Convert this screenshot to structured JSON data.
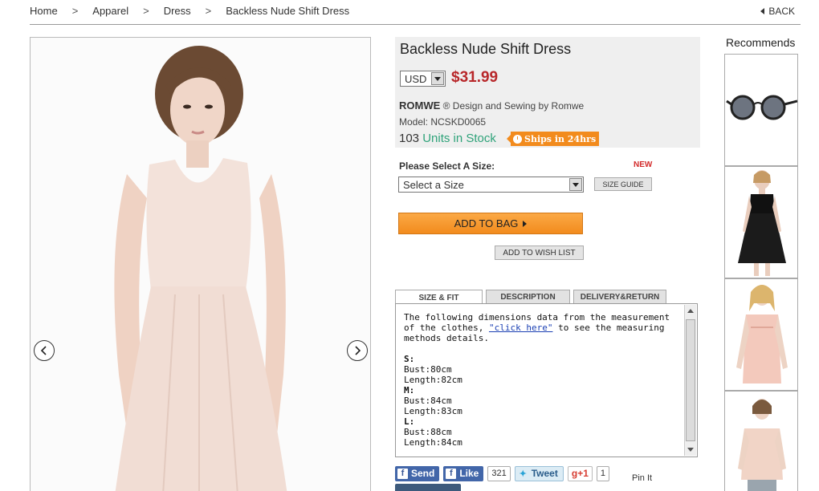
{
  "breadcrumb": {
    "items": [
      "Home",
      "Apparel",
      "Dress",
      "Backless Nude Shift Dress"
    ],
    "separator": ">"
  },
  "back_label": "BACK",
  "product": {
    "title": "Backless Nude Shift Dress",
    "currency": "USD",
    "price": "$31.99",
    "brand": "ROMWE",
    "brand_suffix": "® Design and Sewing by Romwe",
    "model": "Model: NCSKD0065",
    "stock_count": "103",
    "stock_label": "Units in Stock",
    "ships_badge": "Ships in 24hrs",
    "price_color": "#b8272a",
    "stock_color": "#2fa37a",
    "accent_orange": "#f28b1d"
  },
  "size": {
    "label": "Please Select A Size:",
    "new_badge": "NEW",
    "selected": "Select a Size",
    "guide_button": "SIZE GUIDE"
  },
  "actions": {
    "add_to_bag": "ADD TO BAG",
    "wish_list": "ADD TO WISH LIST"
  },
  "tabs": [
    {
      "label": "SIZE & FIT",
      "active": true
    },
    {
      "label": "DESCRIPTION",
      "active": false
    },
    {
      "label": "DELIVERY&RETURN",
      "active": false
    }
  ],
  "size_fit": {
    "intro_a": "The following dimensions data from the measurement of the clothes, ",
    "link": "\"click here\"",
    "intro_b": " to see the measuring methods details.",
    "sizes": [
      {
        "name": "S:",
        "bust": "Bust:80cm",
        "length": "Length:82cm"
      },
      {
        "name": "M:",
        "bust": "Bust:84cm",
        "length": "Length:83cm"
      },
      {
        "name": "L:",
        "bust": "Bust:88cm",
        "length": "Length:84cm"
      }
    ]
  },
  "social": {
    "send": "Send",
    "like": "Like",
    "like_count": "321",
    "tweet": "Tweet",
    "gplus": "+1",
    "gplus_count": "1",
    "pin": "Pin It"
  },
  "recommends": {
    "title": "Recommends",
    "items": [
      {
        "icon": "sunglasses-thumbnail"
      },
      {
        "icon": "black-dress-thumbnail"
      },
      {
        "icon": "pink-blouse-thumbnail"
      },
      {
        "icon": "pink-top-thumbnail"
      }
    ]
  }
}
